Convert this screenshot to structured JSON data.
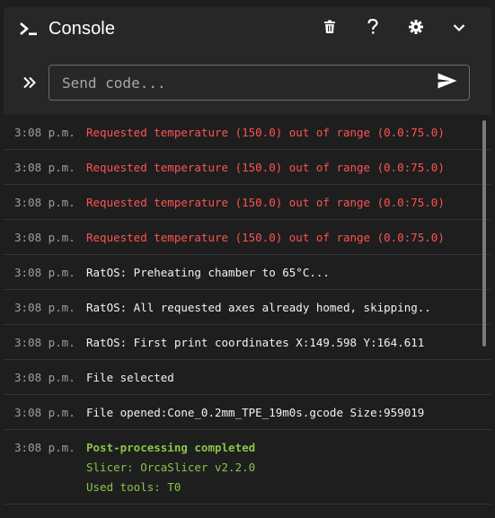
{
  "header": {
    "title": "Console",
    "icon": "console-prompt-icon",
    "actions": [
      {
        "name": "clear-console-button",
        "icon": "trash-icon"
      },
      {
        "name": "help-button",
        "icon": "question-mark-icon"
      },
      {
        "name": "settings-button",
        "icon": "gear-icon"
      },
      {
        "name": "collapse-button",
        "icon": "chevron-down-icon"
      }
    ]
  },
  "send": {
    "prefix_icon": "double-chevron-right-icon",
    "placeholder": "Send code...",
    "value": "",
    "send_icon": "send-icon"
  },
  "log": [
    {
      "time": "3:08 p.m.",
      "type": "error",
      "lines": [
        "Requested temperature (150.0) out of range (0.0:75.0)"
      ]
    },
    {
      "time": "3:08 p.m.",
      "type": "error",
      "lines": [
        "Requested temperature (150.0) out of range (0.0:75.0)"
      ]
    },
    {
      "time": "3:08 p.m.",
      "type": "error",
      "lines": [
        "Requested temperature (150.0) out of range (0.0:75.0)"
      ]
    },
    {
      "time": "3:08 p.m.",
      "type": "error",
      "lines": [
        "Requested temperature (150.0) out of range (0.0:75.0)"
      ]
    },
    {
      "time": "3:08 p.m.",
      "type": "normal",
      "lines": [
        "RatOS: Preheating chamber to 65°C..."
      ]
    },
    {
      "time": "3:08 p.m.",
      "type": "normal",
      "lines": [
        "RatOS: All requested axes already homed, skipping.."
      ]
    },
    {
      "time": "3:08 p.m.",
      "type": "normal",
      "lines": [
        "RatOS: First print coordinates X:149.598 Y:164.611"
      ]
    },
    {
      "time": "3:08 p.m.",
      "type": "normal",
      "lines": [
        "File selected"
      ]
    },
    {
      "time": "3:08 p.m.",
      "type": "normal",
      "lines": [
        "File opened:Cone_0.2mm_TPE_19m0s.gcode Size:959019"
      ]
    },
    {
      "time": "3:08 p.m.",
      "type": "success",
      "lines": [
        "Post-processing completed",
        "Slicer: OrcaSlicer v2.2.0",
        "Used tools: T0"
      ]
    }
  ],
  "colors": {
    "error": "#ff5252",
    "normal": "#f2f2f2",
    "success": "#8bc34a",
    "timestamp": "#9e9e9e"
  }
}
